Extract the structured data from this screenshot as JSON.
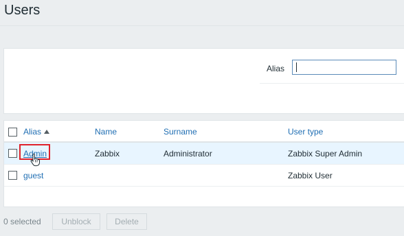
{
  "page": {
    "title": "Users"
  },
  "filter": {
    "alias_label": "Alias",
    "alias_value": ""
  },
  "table": {
    "columns": {
      "alias": "Alias",
      "name": "Name",
      "surname": "Surname",
      "user_type": "User type"
    },
    "rows": [
      {
        "alias": "Admin",
        "name": "Zabbix",
        "surname": "Administrator",
        "user_type": "Zabbix Super Admin"
      },
      {
        "alias": "guest",
        "name": "",
        "surname": "",
        "user_type": "Zabbix User"
      }
    ]
  },
  "footer": {
    "selected": "0 selected",
    "unblock_label": "Unblock",
    "delete_label": "Delete"
  },
  "colors": {
    "link": "#1f6eb3",
    "highlight": "#e0212a",
    "selected_row": "#e8f5ff"
  },
  "icons": {
    "sort": "sort-ascending-icon",
    "cursor": "hand-pointer-icon"
  }
}
